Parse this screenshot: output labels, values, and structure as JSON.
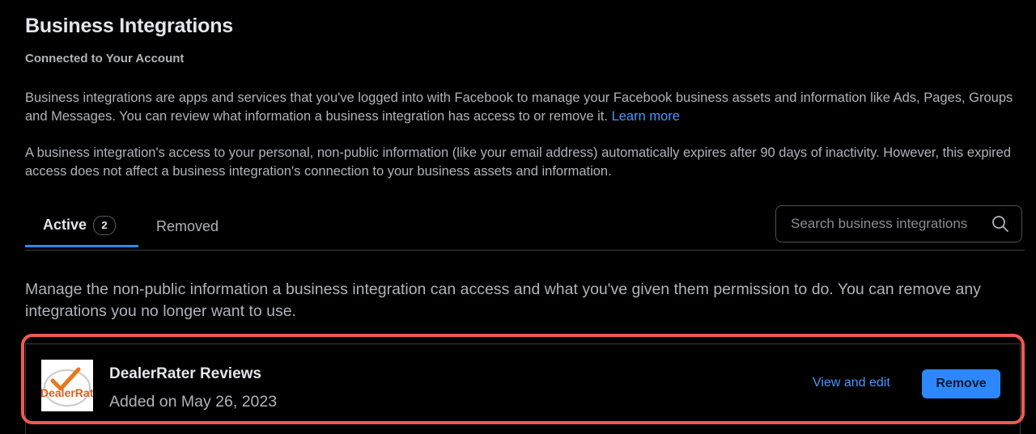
{
  "header": {
    "title": "Business Integrations",
    "subtitle": "Connected to Your Account"
  },
  "description": {
    "paragraph1": "Business integrations are apps and services that you've logged into with Facebook to manage your Facebook business assets and information like Ads, Pages, Groups and Messages. You can review what information a business integration has access to or remove it.",
    "learn_more": "Learn more",
    "paragraph2": "A business integration's access to your personal, non-public information (like your email address) automatically expires after 90 days of inactivity. However, this expired access does not affect a business integration's connection to your business assets and information."
  },
  "tabs": [
    {
      "label": "Active",
      "count": "2",
      "selected": true
    },
    {
      "label": "Removed",
      "selected": false
    }
  ],
  "search": {
    "placeholder": "Search business integrations",
    "icon": "search-icon"
  },
  "manage_text": "Manage the non-public information a business integration can access and what you've given them permission to do. You can remove any integrations you no longer want to use.",
  "integrations": [
    {
      "name": "DealerRater Reviews",
      "added": "Added on May 26, 2023",
      "logo_text": "DealerRat",
      "view_edit_label": "View and edit",
      "remove_label": "Remove"
    }
  ],
  "colors": {
    "background": "#000000",
    "accent": "#2d88ff",
    "link": "#4599ff",
    "highlight": "#ee5a52"
  }
}
